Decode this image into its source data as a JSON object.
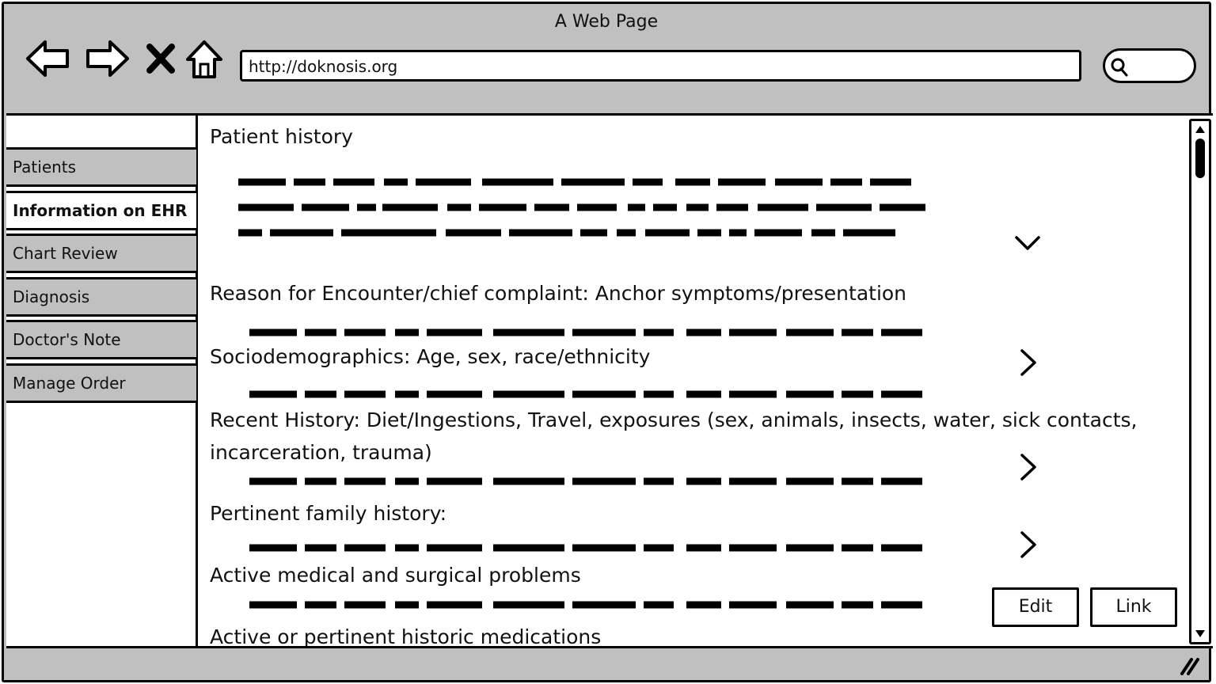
{
  "window": {
    "title": "A Web Page",
    "url": "http://doknosis.org"
  },
  "toolbar": {
    "icons": [
      "back-arrow-icon",
      "forward-arrow-icon",
      "stop-icon",
      "home-icon",
      "search-icon"
    ]
  },
  "sidebar": {
    "items": [
      {
        "label": "Patients",
        "active": false
      },
      {
        "label": "Information on EHR",
        "active": true
      },
      {
        "label": "Chart Review",
        "active": false
      },
      {
        "label": "Diagnosis",
        "active": false
      },
      {
        "label": "Doctor's Note",
        "active": false
      },
      {
        "label": "Manage Order",
        "active": false
      }
    ]
  },
  "main": {
    "title": "Patient history",
    "sections": [
      {
        "label": "Reason for Encounter/chief complaint: Anchor symptoms/presentation"
      },
      {
        "label": "Sociodemographics: Age, sex, race/ethnicity"
      },
      {
        "label": "Recent History: Diet/Ingestions, Travel, exposures (sex, animals, insects, water, sick contacts, incarceration, trauma)"
      },
      {
        "label": "Pertinent family history:"
      },
      {
        "label": "Active medical and surgical problems"
      },
      {
        "label": "Active or pertinent historic medications"
      }
    ],
    "buttons": {
      "edit": "Edit",
      "link": "Link"
    }
  },
  "colors": {
    "chrome": "#c0c0c0",
    "ink": "#000000",
    "panel": "#ffffff"
  }
}
